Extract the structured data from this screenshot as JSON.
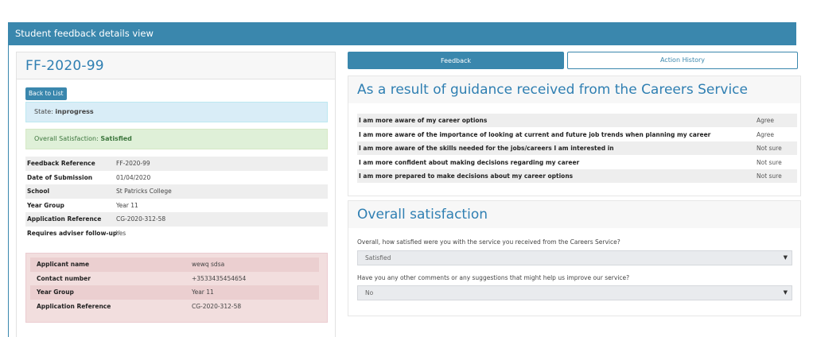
{
  "header": {
    "title": "Student feedback details view"
  },
  "record": {
    "id": "FF-2020-99",
    "back_label": "Back to List",
    "state_label": "State:",
    "state_value": "inprogress",
    "satisfaction_label": "Overall Satisfaction:",
    "satisfaction_value": "Satisfied",
    "details": [
      {
        "label": "Feedback Reference",
        "value": "FF-2020-99"
      },
      {
        "label": "Date of Submission",
        "value": "01/04/2020"
      },
      {
        "label": "School",
        "value": "St Patricks College"
      },
      {
        "label": "Year Group",
        "value": "Year 11"
      },
      {
        "label": "Application Reference",
        "value": "CG-2020-312-58"
      },
      {
        "label": "Requires adviser follow-up",
        "value": "Yes"
      }
    ],
    "applicant": [
      {
        "label": "Applicant name",
        "value": "wewq sdsa"
      },
      {
        "label": "Contact number",
        "value": "+3533435454654"
      },
      {
        "label": "Year Group",
        "value": "Year 11"
      },
      {
        "label": "Application Reference",
        "value": "CG-2020-312-58"
      }
    ]
  },
  "tabs": {
    "feedback": "Feedback",
    "history": "Action History"
  },
  "guidance": {
    "title": "As a result of guidance received from the Careers Service",
    "rows": [
      {
        "q": "I am more aware of my career options",
        "a": "Agree"
      },
      {
        "q": "I am more aware of the importance of looking at current and future job trends when planning my career",
        "a": "Agree"
      },
      {
        "q": "I am more aware of the skills needed for the jobs/careers I am interested in",
        "a": "Not sure"
      },
      {
        "q": "I am more confident about making decisions regarding my career",
        "a": "Not sure"
      },
      {
        "q": "I am more prepared to make decisions about my career options",
        "a": "Not sure"
      }
    ]
  },
  "satisfaction": {
    "title": "Overall satisfaction",
    "q1": "Overall, how satisfied were you with the service you received from the Careers Service?",
    "a1": "Satisfied",
    "q2": "Have you any other comments or any suggestions that might help us improve our service?",
    "a2": "No",
    "caret_icon": "▼"
  }
}
